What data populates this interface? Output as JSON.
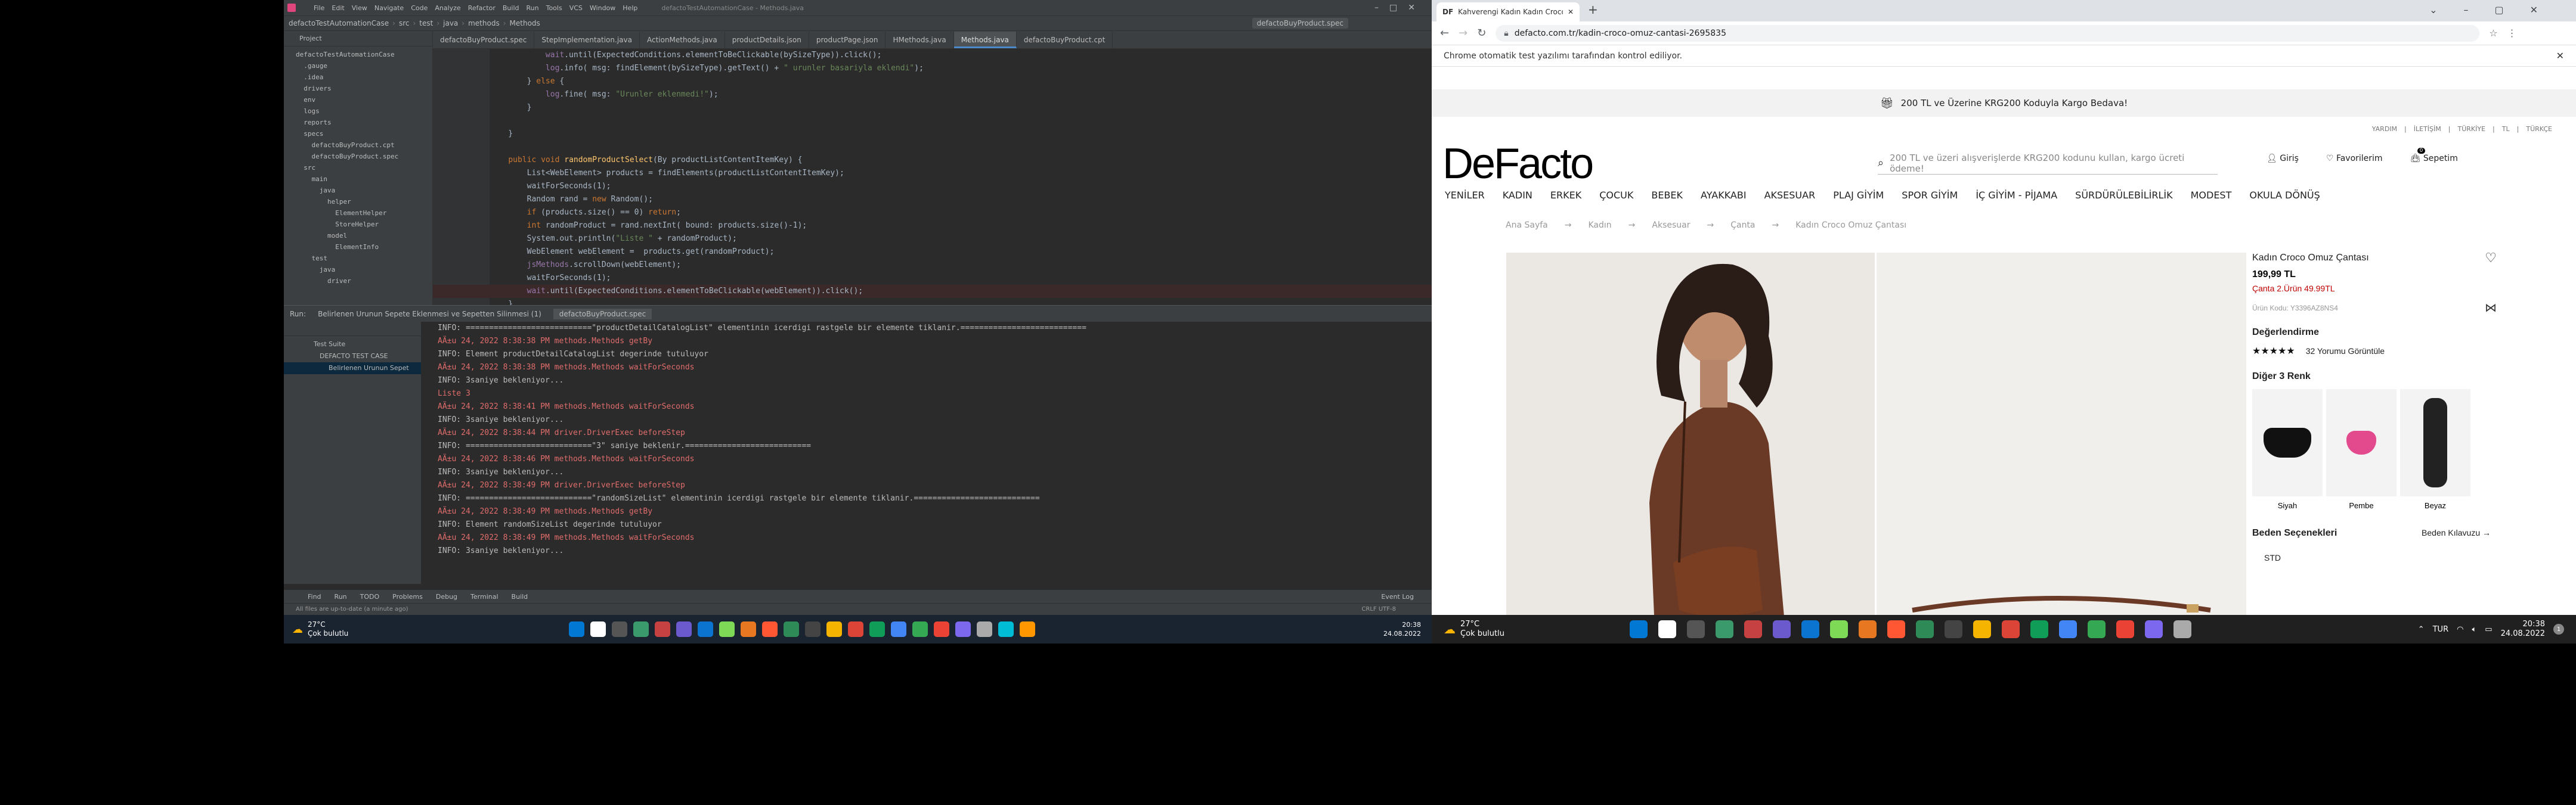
{
  "ide": {
    "title": "defactoTestAutomationCase - Methods.java",
    "menu": [
      "File",
      "Edit",
      "View",
      "Navigate",
      "Code",
      "Analyze",
      "Refactor",
      "Build",
      "Run",
      "Tools",
      "VCS",
      "Window",
      "Help"
    ],
    "breadcrumb": [
      "defactoTestAutomationCase",
      "src",
      "test",
      "java",
      "methods",
      "Methods"
    ],
    "run_config": "defactoBuyProduct.spec",
    "tabs": [
      "defactoBuyProduct.spec",
      "StepImplementation.java",
      "ActionMethods.java",
      "productDetails.json",
      "productPage.json",
      "HMethods.java",
      "Methods.java",
      "defactoBuyProduct.cpt"
    ],
    "active_tab": "Methods.java",
    "project_label": "Project",
    "tree": [
      "defactoTestAutomationCase",
      "  .gauge",
      "  .idea",
      "  drivers",
      "  env",
      "  logs",
      "  reports",
      "  specs",
      "    defactoBuyProduct.cpt",
      "    defactoBuyProduct.spec",
      "  src",
      "    main",
      "      java",
      "        helper",
      "          ElementHelper",
      "          StoreHelper",
      "        model",
      "          ElementInfo",
      "    test",
      "      java",
      "        driver"
    ],
    "line_numbers": [
      "",
      "",
      "",
      "",
      "",
      "",
      "",
      "",
      "",
      "",
      "",
      "",
      "",
      "",
      "",
      "",
      "",
      "",
      "",
      ""
    ],
    "code": [
      "            wait.until(ExpectedConditions.elementToBeClickable(bySizeType)).click();",
      "            log.info( msg: findElement(bySizeType).getText() + \" urunler basariyla eklendi\");",
      "        } else {",
      "            log.fine( msg: \"Urunler eklenmedi!\");",
      "        }",
      "",
      "    }",
      "",
      "    public void randomProductSelect(By productListContentItemKey) {",
      "        List<WebElement> products = findElements(productListContentItemKey);",
      "        waitForSeconds(1);",
      "        Random rand = new Random();",
      "        if (products.size() == 0) return;",
      "        int randomProduct = rand.nextInt( bound: products.size()-1);",
      "        System.out.println(\"Liste \" + randomProduct);",
      "        WebElement webElement =  products.get(randomProduct);",
      "        jsMethods.scrollDown(webElement);",
      "        waitForSeconds(1);",
      "        wait.until(ExpectedConditions.elementToBeClickable(webElement)).click();",
      "    }"
    ],
    "run_tabs": [
      "Run:",
      "Belirlenen Urunun Sepete Eklenmesi ve Sepetten Silinmesi (1)",
      "defactoBuyProduct.spec"
    ],
    "run_tree": [
      "Test Suite",
      "DEFACTO TEST CASE",
      "Belirlenen Urunun Sepet"
    ],
    "console": [
      "INFO: ===========================\"productDetailCatalogList\" elementinin icerdigi rastgele bir elemente tiklanir.===========================",
      "AÄ±u 24, 2022 8:38:38 PM methods.Methods getBy",
      "INFO: Element productDetailCatalogList degerinde tutuluyor",
      "AÄ±u 24, 2022 8:38:38 PM methods.Methods waitForSeconds",
      "INFO: 3saniye bekleniyor...",
      "Liste 3",
      "AÄ±u 24, 2022 8:38:41 PM methods.Methods waitForSeconds",
      "INFO: 3saniye bekleniyor...",
      "AÄ±u 24, 2022 8:38:44 PM driver.DriverExec beforeStep",
      "INFO: ===========================\"3\" saniye beklenir.===========================",
      "AÄ±u 24, 2022 8:38:46 PM methods.Methods waitForSeconds",
      "INFO: 3saniye bekleniyor...",
      "AÄ±u 24, 2022 8:38:49 PM driver.DriverExec beforeStep",
      "INFO: ===========================\"randomSizeList\" elementinin icerdigi rastgele bir elemente tiklanir.===========================",
      "AÄ±u 24, 2022 8:38:49 PM methods.Methods getBy",
      "INFO: Element randomSizeList degerinde tutuluyor",
      "AÄ±u 24, 2022 8:38:49 PM methods.Methods waitForSeconds",
      "INFO: 3saniye bekleniyor..."
    ],
    "bottom_tabs": [
      "Find",
      "Run",
      "TODO",
      "Problems",
      "Debug",
      "Terminal",
      "Build"
    ],
    "event_log": "Event Log",
    "status": "All files are up-to-date (a minute ago)",
    "status_right": "CRLF  UTF-8"
  },
  "taskbar_left": {
    "weather_temp": "27°C",
    "weather_text": "Çok bulutlu",
    "time": "20:38",
    "date": "24.08.2022"
  },
  "browser": {
    "tab_title": "Kahverengi Kadın Kadın Croco O",
    "url": "defacto.com.tr/kadin-croco-omuz-cantasi-2695835",
    "automation_notice": "Chrome otomatik test yazılımı tarafından kontrol ediliyor.",
    "promo": "200 TL ve Üzerine KRG200 Koduyla Kargo Bedava!",
    "util_links": [
      "YARDIM",
      "|",
      "İLETİŞİM",
      "|",
      "TÜRKİYE",
      "|",
      "TL",
      "|",
      "TÜRKÇE"
    ],
    "logo": "DeFacto",
    "search_placeholder": "200 TL ve üzeri alışverişlerde KRG200 kodunu kullan, kargo ücreti ödeme!",
    "login": "Giriş",
    "favorites": "Favorilerim",
    "cart": "Sepetim",
    "cart_count": "0",
    "categories": [
      "YENİLER",
      "KADIN",
      "ERKEK",
      "ÇOCUK",
      "BEBEK",
      "AYAKKABI",
      "AKSESUAR",
      "PLAJ GİYİM",
      "SPOR GİYİM",
      "İÇ GİYİM - PİJAMA",
      "SÜRDÜRÜLEBİLİRLİK",
      "MODEST",
      "OKULA DÖNÜŞ"
    ],
    "breadcrumbs": [
      "Ana Sayfa",
      "Kadın",
      "Aksesuar",
      "Çanta",
      "Kadın Croco Omuz Çantası"
    ],
    "product": {
      "name": "Kadın Croco Omuz Çantası",
      "price": "199,99 TL",
      "campaign": "Çanta 2.Ürün 49.99TL",
      "code": "Ürün Kodu: Y3396AZ8NS4",
      "reviews_title": "Değerlendirme",
      "stars": "★★★★★",
      "reviews_count": "32 Yorumu Görüntüle",
      "colors_title": "Diğer 3 Renk",
      "colors": [
        "Siyah",
        "Pembe",
        "Beyaz"
      ],
      "size_title": "Beden Seçenekleri",
      "size_guide": "Beden Kılavuzu",
      "size": "STD"
    }
  },
  "taskbar_right": {
    "weather_temp": "27°C",
    "weather_text": "Çok bulutlu",
    "lang": "TUR",
    "time": "20:38",
    "date": "24.08.2022",
    "notif": "1"
  },
  "colors": {
    "ide_bg": "#2b2b2b",
    "ide_panel": "#3c3f41",
    "brand_red": "#c00000"
  }
}
